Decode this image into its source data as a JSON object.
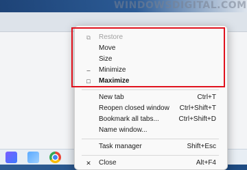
{
  "watermark": "WINDOWSDIGITAL.COM",
  "menu": {
    "items": [
      {
        "label": "Restore",
        "glyph": "⧉",
        "shortcut": "",
        "disabled": true,
        "bold": false
      },
      {
        "label": "Move",
        "glyph": "",
        "shortcut": "",
        "disabled": false,
        "bold": false
      },
      {
        "label": "Size",
        "glyph": "",
        "shortcut": "",
        "disabled": false,
        "bold": false
      },
      {
        "label": "Minimize",
        "glyph": "‒",
        "shortcut": "",
        "disabled": false,
        "bold": false
      },
      {
        "label": "Maximize",
        "glyph": "□",
        "shortcut": "",
        "disabled": false,
        "bold": true
      },
      {
        "label": "New tab",
        "glyph": "",
        "shortcut": "Ctrl+T",
        "disabled": false,
        "bold": false
      },
      {
        "label": "Reopen closed window",
        "glyph": "",
        "shortcut": "Ctrl+Shift+T",
        "disabled": false,
        "bold": false
      },
      {
        "label": "Bookmark all tabs...",
        "glyph": "",
        "shortcut": "Ctrl+Shift+D",
        "disabled": false,
        "bold": false
      },
      {
        "label": "Name window...",
        "glyph": "",
        "shortcut": "",
        "disabled": false,
        "bold": false
      },
      {
        "label": "Task manager",
        "glyph": "",
        "shortcut": "Shift+Esc",
        "disabled": false,
        "bold": false
      },
      {
        "label": "Close",
        "glyph": "✕",
        "shortcut": "Alt+F4",
        "disabled": false,
        "bold": false
      }
    ]
  },
  "colors": {
    "highlight": "#e0101c",
    "menu_background": "#f9f9f9"
  },
  "taskbar": {
    "icons": [
      "messenger-icon",
      "photos-icon",
      "chrome-icon"
    ]
  }
}
